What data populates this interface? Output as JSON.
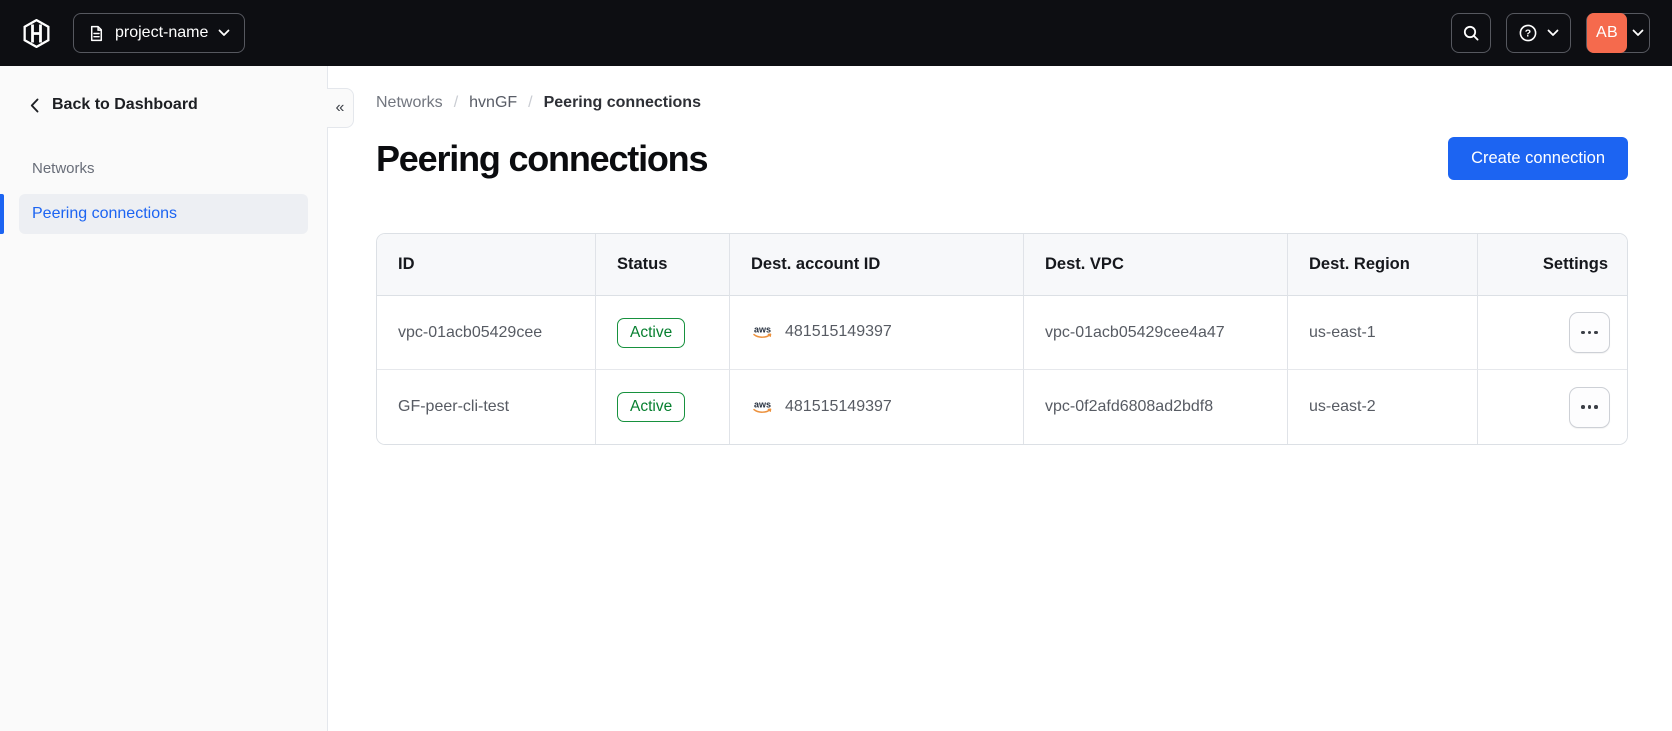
{
  "topbar": {
    "project_switcher": {
      "label": "project-name"
    },
    "user_menu": {
      "initials": "AB"
    }
  },
  "sidebar": {
    "back_label": "Back to Dashboard",
    "section_label": "Networks",
    "collapse_glyph": "«",
    "items": [
      {
        "label": "Peering connections",
        "active": true
      }
    ]
  },
  "breadcrumb": {
    "items": [
      "Networks",
      "hvnGF",
      "Peering connections"
    ],
    "separator": "/"
  },
  "page": {
    "title": "Peering connections",
    "create_button_label": "Create connection"
  },
  "table": {
    "columns": [
      "ID",
      "Status",
      "Dest. account ID",
      "Dest. VPC",
      "Dest. Region",
      "Settings"
    ],
    "rows": [
      {
        "id": "vpc-01acb05429cee",
        "status": "Active",
        "dest_account_id": "481515149397",
        "dest_vpc": "vpc-01acb05429cee4a47",
        "dest_region": "us-east-1"
      },
      {
        "id": "GF-peer-cli-test",
        "status": "Active",
        "dest_account_id": "481515149397",
        "dest_vpc": "vpc-0f2afd6808ad2bdf8",
        "dest_region": "us-east-2"
      }
    ]
  },
  "icons": {
    "logo": "hashicorp-logo",
    "project": "document-icon",
    "search": "search-icon",
    "help": "help-icon",
    "back": "chevron-left-icon",
    "collapse": "collapse-icon",
    "provider": "aws-icon",
    "row_settings": "ellipsis-icon"
  },
  "colors": {
    "topbar_bg": "#0d0e12",
    "accent_blue": "#1c64f2",
    "status_green": "#067f2f",
    "avatar_orange": "#f56a4d",
    "sidebar_bg": "#fafafa",
    "table_header_bg": "#f7f8fa"
  }
}
